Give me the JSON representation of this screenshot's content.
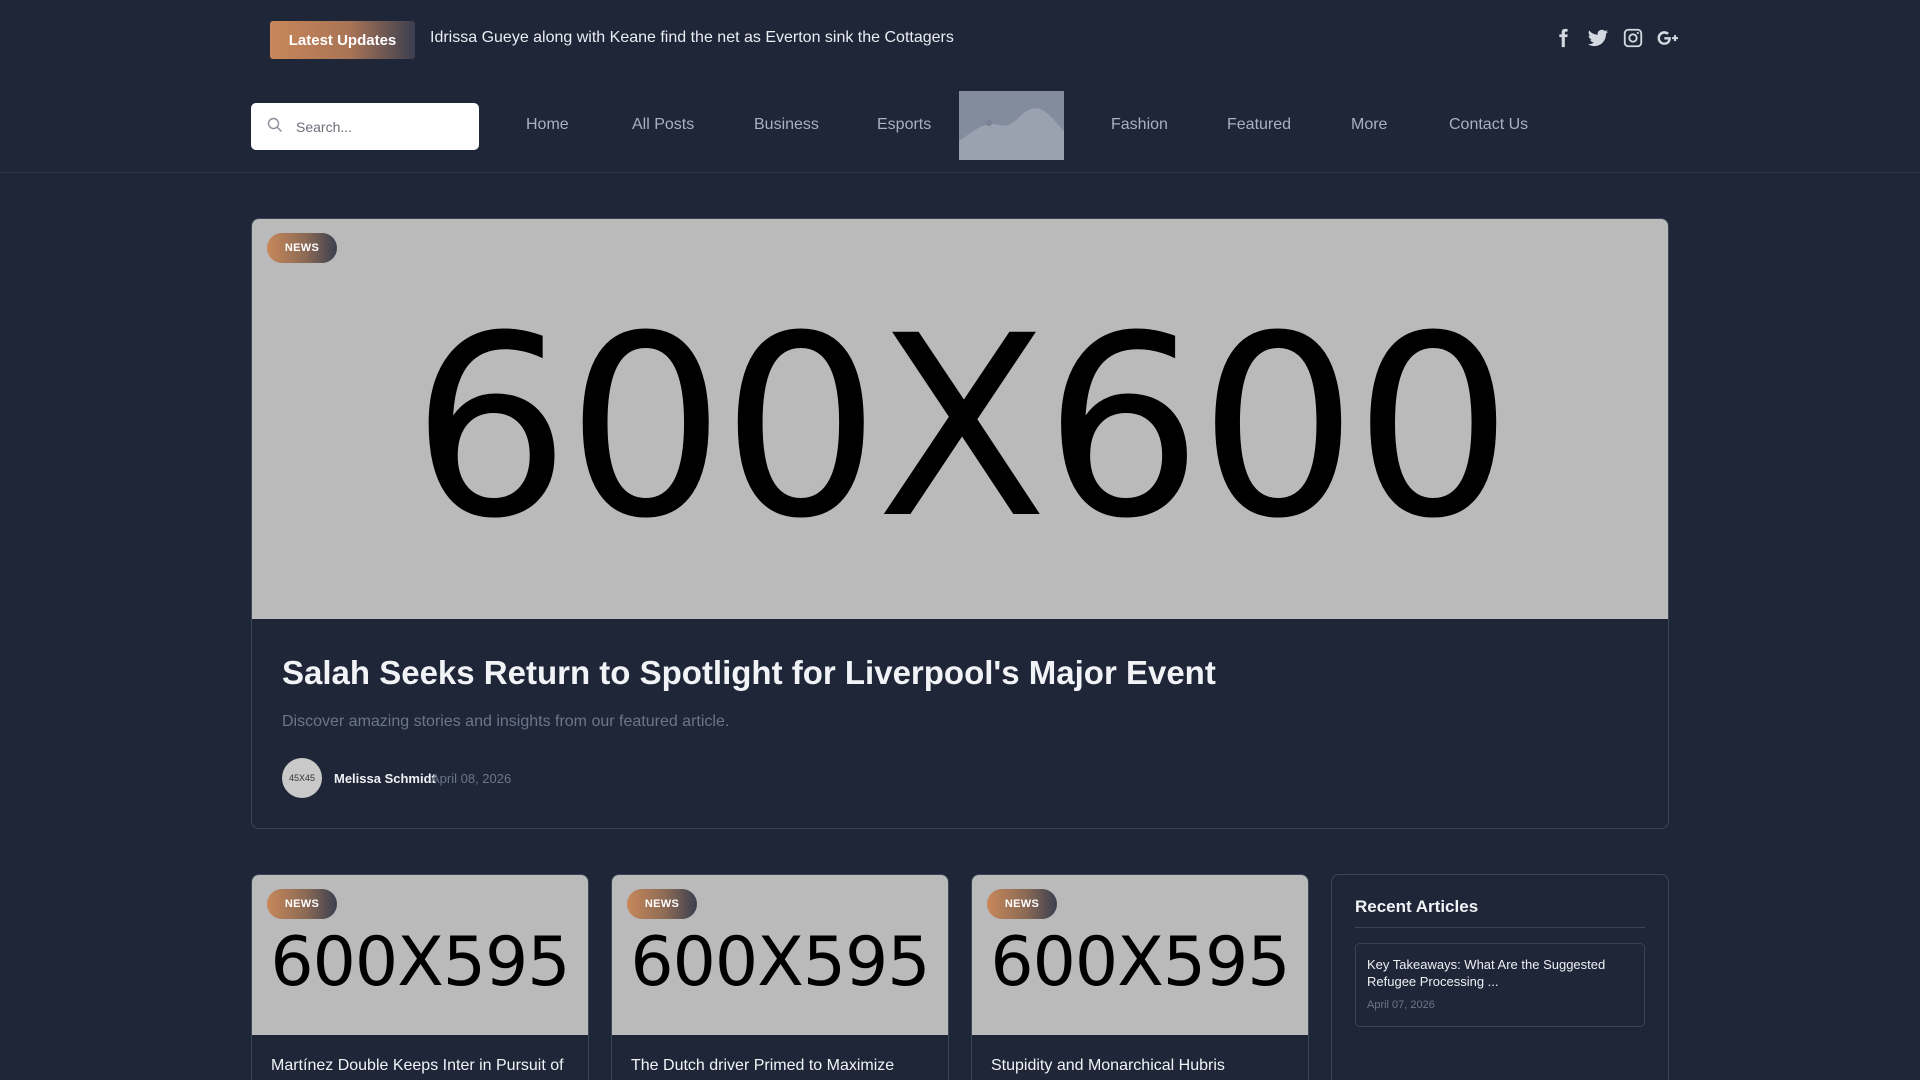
{
  "topbar": {
    "latest_label": "Latest Updates",
    "ticker_text": "Idrissa Gueye along with Keane find the net as Everton sink the Cottagers",
    "socials": [
      "facebook-icon",
      "twitter-icon",
      "instagram-icon",
      "google-plus-icon"
    ]
  },
  "nav": {
    "search_placeholder": "Search...",
    "items": [
      "Home",
      "All Posts",
      "Business",
      "Esports",
      "Fashion",
      "Featured",
      "More",
      "Contact Us"
    ]
  },
  "hero": {
    "category": "NEWS",
    "image_text": "600X600",
    "title": "Salah Seeks Return to Spotlight for Liverpool's Major Event",
    "description": "Discover amazing stories and insights from our featured article.",
    "avatar_text": "45X45",
    "author": "Melissa Schmidt",
    "date": "April 08, 2026"
  },
  "cards": [
    {
      "category": "NEWS",
      "image_text": "600X595",
      "title": "Martínez Double Keeps Inter in Pursuit of"
    },
    {
      "category": "NEWS",
      "image_text": "600X595",
      "title": "The Dutch driver Primed to Maximize"
    },
    {
      "category": "NEWS",
      "image_text": "600X595",
      "title": "Stupidity and Monarchical Hubris"
    }
  ],
  "sidebar": {
    "title": "Recent Articles",
    "items": [
      {
        "title": "Key Takeaways: What Are the Suggested Refugee Processing ...",
        "date": "April 07, 2026"
      }
    ]
  },
  "colors": {
    "background": "#1e2638",
    "accent_start": "#c8875a",
    "accent_end": "#3b3f4f",
    "placeholder_gray": "#bababa"
  }
}
